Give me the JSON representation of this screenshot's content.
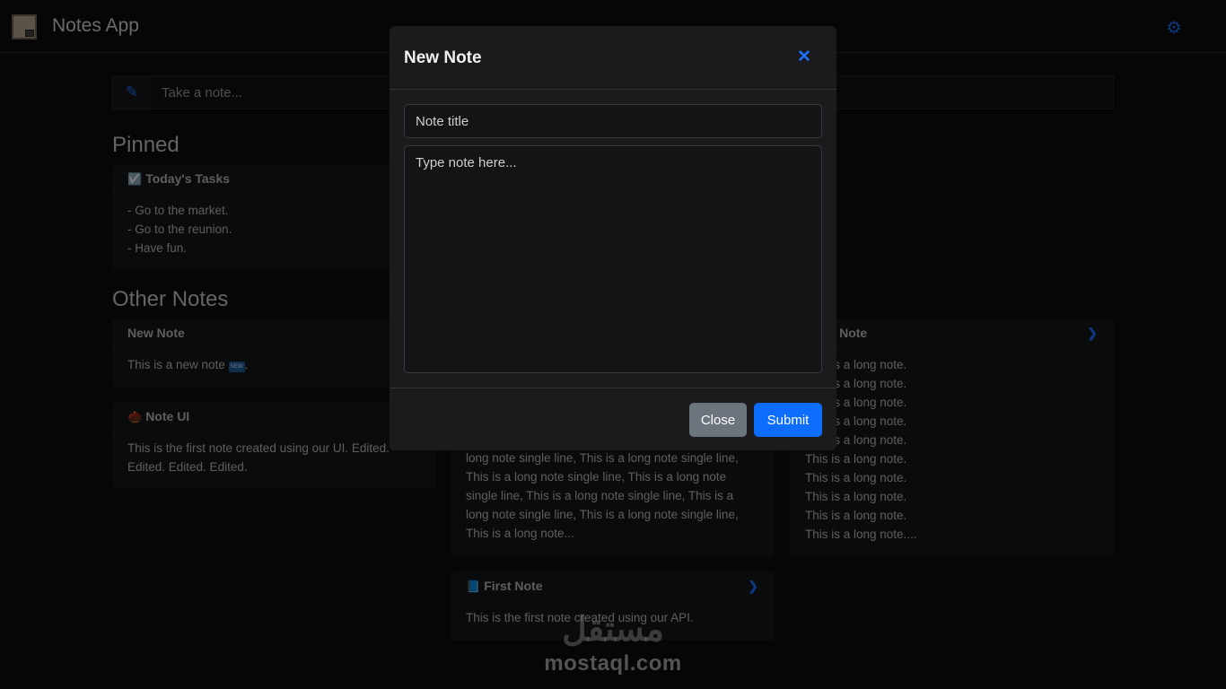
{
  "header": {
    "app_title": "Notes App",
    "logo_icon": "notebook-logo-icon",
    "settings_icon": "gear-icon"
  },
  "quick_entry": {
    "icon": "pencil-icon",
    "placeholder": "Take a note..."
  },
  "pinned": {
    "title": "Pinned",
    "notes": [
      {
        "icon": "checkbox-icon",
        "emoji": "☑️",
        "title": "Today's Tasks",
        "lines": [
          "- Go to the market.",
          "- Go to the reunion.",
          "- Have fun."
        ]
      }
    ]
  },
  "other": {
    "title": "Other Notes",
    "notes": [
      {
        "title": "New Note",
        "text_before": "This is a new note ",
        "badge": "NEW",
        "text_after": "."
      },
      {
        "emoji": "🌰",
        "title": "Note UI",
        "text": "This is the first note created using our UI. Edited. Edited. Edited. Edited."
      },
      {
        "title": "Long Note",
        "lines": [
          "This is a long note.",
          "This is a long note.",
          "This is a long note.",
          "This is a long note.",
          "This is a long note.",
          "This is a long note.",
          "This is a long note.",
          "This is a long note.",
          "This is a long note.",
          "This is a long note...."
        ]
      },
      {
        "text": "long note single line, This is a long note single line, This is a long note single line, This is a long note single line, This is a long note single line, This is a long note single line, This is a long note single line, This is a long note..."
      },
      {
        "emoji": "📘",
        "title": "First Note",
        "text": "This is the first note created using our API."
      }
    ]
  },
  "modal": {
    "title": "New Note",
    "close_icon": "close-icon",
    "title_placeholder": "Note title",
    "body_placeholder": "Type note here...",
    "close_label": "Close",
    "submit_label": "Submit"
  },
  "watermark": {
    "arabic": "مستقل",
    "latin": "mostaql.com"
  },
  "colors": {
    "background": "#0d0d0f",
    "card": "#151619",
    "accent": "#1d6fff",
    "submit": "#0d6efd",
    "close_button": "#6c757d"
  }
}
